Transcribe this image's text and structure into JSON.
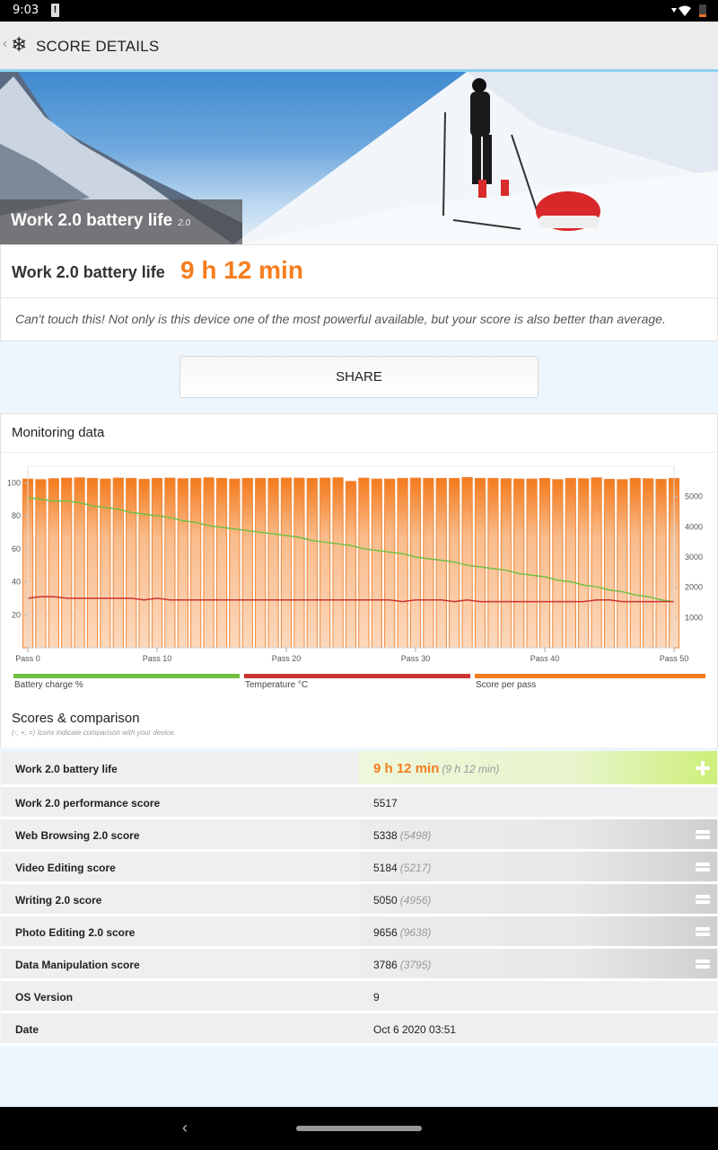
{
  "statusbar": {
    "time": "9:03",
    "alert_icon": "!",
    "icons": [
      "signal-icon",
      "wifi-icon",
      "battery-icon"
    ]
  },
  "appbar": {
    "back_icon": "‹",
    "logo_icon": "❄",
    "title": "SCORE DETAILS"
  },
  "hero": {
    "title": "Work 2.0 battery life",
    "version": "2.0"
  },
  "result": {
    "label": "Work 2.0 battery life",
    "value": "9 h 12 min",
    "description": "Can't touch this! Not only is this device one of the most powerful available, but your score is also better than average."
  },
  "share_button": {
    "label": "SHARE"
  },
  "monitoring": {
    "title": "Monitoring data",
    "legend": [
      {
        "label": "Battery charge %",
        "color": "#72c043"
      },
      {
        "label": "Temperature °C",
        "color": "#cc3333"
      },
      {
        "label": "Score per pass",
        "color": "#f57d1f"
      }
    ]
  },
  "chart_data": {
    "type": "bar",
    "title": "Monitoring data",
    "x_tick_labels": [
      "Pass 0",
      "Pass 10",
      "Pass 20",
      "Pass 30",
      "Pass 40",
      "Pass 50"
    ],
    "x_ticks": [
      0,
      10,
      20,
      30,
      40,
      50
    ],
    "y_left": {
      "ylim": [
        0,
        110
      ],
      "ticks": [
        20,
        40,
        60,
        80,
        100
      ]
    },
    "y_right": {
      "ylim": [
        0,
        6000
      ],
      "ticks": [
        1000,
        2000,
        3000,
        4000,
        5000
      ]
    },
    "grid": true,
    "series": [
      {
        "name": "Score per pass",
        "type": "bar",
        "axis": "right",
        "color": "#f57d1f",
        "values": [
          5580,
          5560,
          5590,
          5610,
          5620,
          5600,
          5580,
          5610,
          5600,
          5570,
          5600,
          5610,
          5590,
          5600,
          5620,
          5600,
          5580,
          5600,
          5600,
          5600,
          5610,
          5610,
          5600,
          5610,
          5620,
          5500,
          5610,
          5580,
          5580,
          5600,
          5610,
          5600,
          5600,
          5600,
          5630,
          5600,
          5600,
          5590,
          5580,
          5580,
          5600,
          5560,
          5600,
          5590,
          5620,
          5570,
          5560,
          5600,
          5590,
          5570,
          5600
        ]
      },
      {
        "name": "Battery charge %",
        "type": "line",
        "axis": "left",
        "color": "#72c043",
        "values": [
          91,
          90,
          89,
          89,
          88,
          86,
          85,
          84,
          82,
          81,
          80,
          79,
          77,
          76,
          74,
          73,
          72,
          71,
          70,
          69,
          68,
          67,
          65,
          64,
          63,
          62,
          60,
          59,
          58,
          57,
          55,
          54,
          53,
          52,
          50,
          49,
          48,
          47,
          45,
          44,
          43,
          41,
          40,
          38,
          37,
          35,
          34,
          32,
          31,
          29,
          28
        ]
      },
      {
        "name": "Temperature °C",
        "type": "line",
        "axis": "left",
        "color": "#cc3333",
        "values": [
          30,
          31,
          31,
          30,
          30,
          30,
          30,
          30,
          30,
          29,
          30,
          29,
          29,
          29,
          29,
          29,
          29,
          29,
          29,
          29,
          29,
          29,
          29,
          29,
          29,
          29,
          29,
          29,
          29,
          28,
          29,
          29,
          29,
          28,
          29,
          28,
          28,
          28,
          28,
          28,
          28,
          28,
          28,
          28,
          29,
          29,
          28,
          28,
          28,
          28,
          28
        ]
      }
    ]
  },
  "scores": {
    "title": "Scores & comparison",
    "note": "(-, +, =) Icons indicate comparison with your device.",
    "rows": [
      {
        "name": "Work 2.0 battery life",
        "value": "9 h 12 min",
        "reference": "(9 h 12 min)",
        "comparison": "plus-icon"
      },
      {
        "name": "Work 2.0 performance score",
        "value": "5517",
        "reference": "",
        "comparison": ""
      },
      {
        "name": "Web Browsing 2.0 score",
        "value": "5338",
        "reference": "(5498)",
        "comparison": "equals-icon"
      },
      {
        "name": "Video Editing score",
        "value": "5184",
        "reference": "(5217)",
        "comparison": "equals-icon"
      },
      {
        "name": "Writing 2.0 score",
        "value": "5050",
        "reference": "(4956)",
        "comparison": "equals-icon"
      },
      {
        "name": "Photo Editing 2.0 score",
        "value": "9656",
        "reference": "(9638)",
        "comparison": "equals-icon"
      },
      {
        "name": "Data Manipulation score",
        "value": "3786",
        "reference": "(3795)",
        "comparison": "equals-icon"
      },
      {
        "name": "OS Version",
        "value": "9",
        "reference": "",
        "comparison": ""
      },
      {
        "name": "Date",
        "value": "Oct 6 2020 03:51",
        "reference": "",
        "comparison": ""
      }
    ]
  },
  "navbar": {
    "back_icon": "‹"
  }
}
